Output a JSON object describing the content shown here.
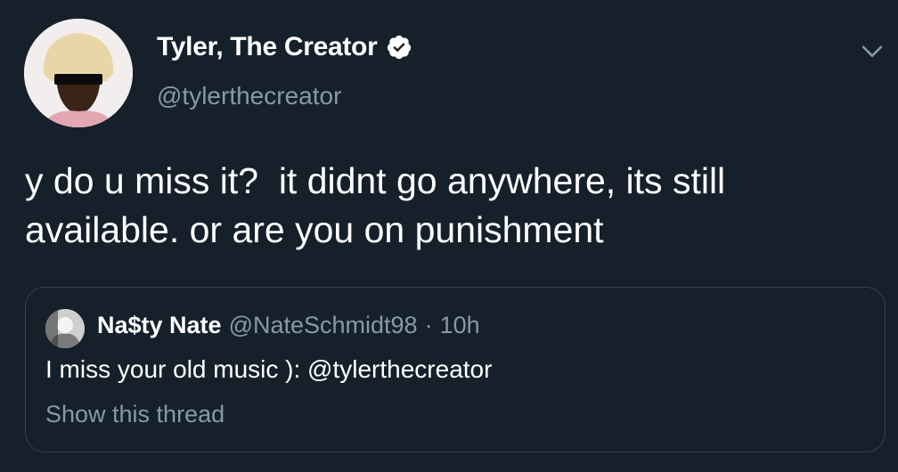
{
  "tweet": {
    "author": {
      "display_name": "Tyler, The Creator",
      "handle": "@tylerthecreator",
      "verified": true
    },
    "text": "y do u miss it?  it didnt go anywhere, its still available. or are you on punishment",
    "menu_icon": "chevron-down-icon"
  },
  "quoted_tweet": {
    "author": {
      "display_name": "Na$ty Nate",
      "handle": "@NateSchmidt98"
    },
    "separator": "·",
    "time": "10h",
    "text": "I miss your old music ): @tylerthecreator",
    "show_thread_label": "Show this thread"
  },
  "colors": {
    "background": "#15202b",
    "primary_text": "#ffffff",
    "secondary_text": "#8899a6",
    "border": "#38444d",
    "verified_badge": "#ffffff"
  }
}
